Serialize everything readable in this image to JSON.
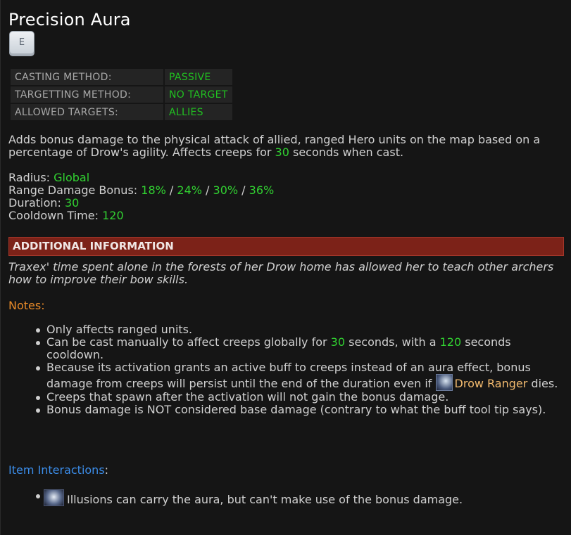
{
  "ability": {
    "title": "Precision Aura",
    "hotkey": "E"
  },
  "info_table": [
    {
      "label": "CASTING METHOD:",
      "value": "PASSIVE"
    },
    {
      "label": "TARGETTING METHOD:",
      "value": "NO TARGET"
    },
    {
      "label": "ALLOWED TARGETS:",
      "value": "ALLIES"
    }
  ],
  "description": {
    "part1": "Adds bonus damage to the physical attack of allied, ranged Hero units on the map based on a percentage of Drow's agility. Affects creeps for ",
    "duration": "30",
    "part2": " seconds when cast."
  },
  "stats": {
    "radius_label": "Radius: ",
    "radius_value": "Global",
    "bonus_label": "Range Damage Bonus: ",
    "bonus_values": [
      "18%",
      "24%",
      "30%",
      "36%"
    ],
    "separator": " / ",
    "duration_label": "Duration: ",
    "duration_value": "30",
    "cooldown_label": "Cooldown Time: ",
    "cooldown_value": "120"
  },
  "additional": {
    "header": "ADDITIONAL INFORMATION",
    "lore": "Traxex' time spent alone in the forests of her Drow home has allowed her to teach other archers how to improve their bow skills."
  },
  "notes": {
    "title": "Notes:",
    "n1": "Only affects ranged units.",
    "n2_a": "Can be cast manually to affect creeps globally for ",
    "n2_v1": "30",
    "n2_b": " seconds, with a ",
    "n2_v2": "120",
    "n2_c": " seconds cooldown.",
    "n3_a": "Because its activation grants an active buff to creeps instead of an aura effect, bonus damage from creeps will persist until the end of the duration even if ",
    "n3_link": "Drow Ranger",
    "n3_b": " dies.",
    "n4": "Creeps that spawn after the activation will not gain the bonus damage.",
    "n5": "Bonus damage is NOT considered base damage (contrary to what the buff tool tip says)."
  },
  "items": {
    "title_link": "Item Interactions",
    "title_colon": ":",
    "i1": "Illusions can carry the aura, but can't make use of the bonus damage."
  },
  "icons": {
    "hero": "drow-ranger-portrait-icon",
    "item": "illusion-item-icon"
  },
  "colors": {
    "value_green": "#31d131",
    "notes_orange": "#e88a28",
    "link_blue": "#3b8ce8",
    "header_red": "#7c2218",
    "hero_link": "#f2ba6e"
  }
}
